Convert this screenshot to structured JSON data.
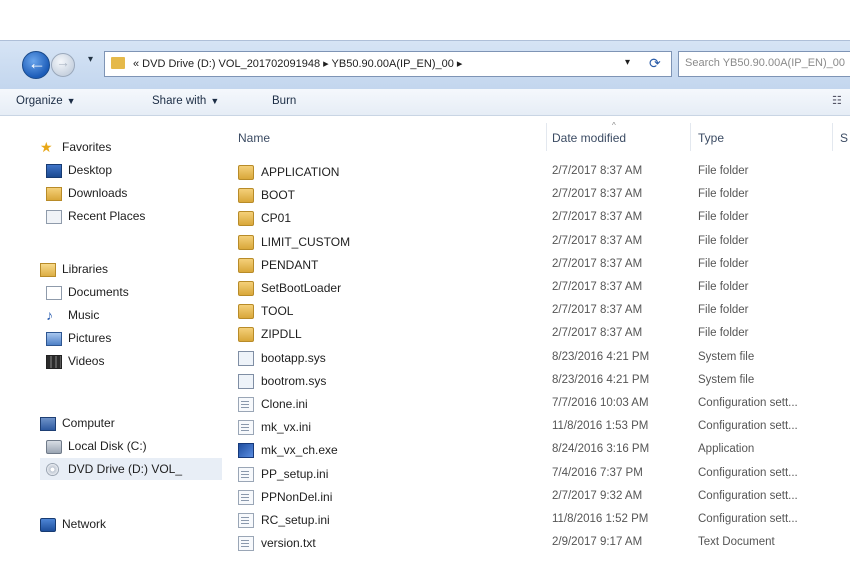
{
  "address_bar": {
    "path_text": "« DVD Drive (D:) VOL_201702091948 ▸ YB50.90.00A(IP_EN)_00 ▸",
    "search_placeholder": "Search YB50.90.00A(IP_EN)_00"
  },
  "toolbar": {
    "organize": "Organize",
    "share_with": "Share with",
    "burn": "Burn"
  },
  "nav": {
    "favorites": {
      "label": "Favorites",
      "items": [
        "Desktop",
        "Downloads",
        "Recent Places"
      ]
    },
    "libraries": {
      "label": "Libraries",
      "items": [
        "Documents",
        "Music",
        "Pictures",
        "Videos"
      ]
    },
    "computer": {
      "label": "Computer",
      "items": [
        "Local Disk (C:)",
        "DVD Drive (D:) VOL_"
      ]
    },
    "network": {
      "label": "Network"
    }
  },
  "columns": {
    "name": "Name",
    "date": "Date modified",
    "type": "Type",
    "size": "S"
  },
  "files": [
    {
      "name": "APPLICATION",
      "date": "2/7/2017 8:37 AM",
      "type": "File folder",
      "icon": "folder-icon"
    },
    {
      "name": "BOOT",
      "date": "2/7/2017 8:37 AM",
      "type": "File folder",
      "icon": "folder-icon"
    },
    {
      "name": "CP01",
      "date": "2/7/2017 8:37 AM",
      "type": "File folder",
      "icon": "folder-icon"
    },
    {
      "name": "LIMIT_CUSTOM",
      "date": "2/7/2017 8:37 AM",
      "type": "File folder",
      "icon": "folder-icon"
    },
    {
      "name": "PENDANT",
      "date": "2/7/2017 8:37 AM",
      "type": "File folder",
      "icon": "folder-icon"
    },
    {
      "name": "SetBootLoader",
      "date": "2/7/2017 8:37 AM",
      "type": "File folder",
      "icon": "folder-icon"
    },
    {
      "name": "TOOL",
      "date": "2/7/2017 8:37 AM",
      "type": "File folder",
      "icon": "folder-icon"
    },
    {
      "name": "ZIPDLL",
      "date": "2/7/2017 8:37 AM",
      "type": "File folder",
      "icon": "folder-icon"
    },
    {
      "name": "bootapp.sys",
      "date": "8/23/2016 4:21 PM",
      "type": "System file",
      "icon": "system-file-icon"
    },
    {
      "name": "bootrom.sys",
      "date": "8/23/2016 4:21 PM",
      "type": "System file",
      "icon": "system-file-icon"
    },
    {
      "name": "Clone.ini",
      "date": "7/7/2016 10:03 AM",
      "type": "Configuration sett...",
      "icon": "config-file-icon"
    },
    {
      "name": "mk_vx.ini",
      "date": "11/8/2016 1:53 PM",
      "type": "Configuration sett...",
      "icon": "config-file-icon"
    },
    {
      "name": "mk_vx_ch.exe",
      "date": "8/24/2016 3:16 PM",
      "type": "Application",
      "icon": "application-icon"
    },
    {
      "name": "PP_setup.ini",
      "date": "7/4/2016 7:37 PM",
      "type": "Configuration sett...",
      "icon": "config-file-icon"
    },
    {
      "name": "PPNonDel.ini",
      "date": "2/7/2017 9:32 AM",
      "type": "Configuration sett...",
      "icon": "config-file-icon"
    },
    {
      "name": "RC_setup.ini",
      "date": "11/8/2016 1:52 PM",
      "type": "Configuration sett...",
      "icon": "config-file-icon"
    },
    {
      "name": "version.txt",
      "date": "2/9/2017 9:17 AM",
      "type": "Text Document",
      "icon": "text-file-icon"
    }
  ]
}
